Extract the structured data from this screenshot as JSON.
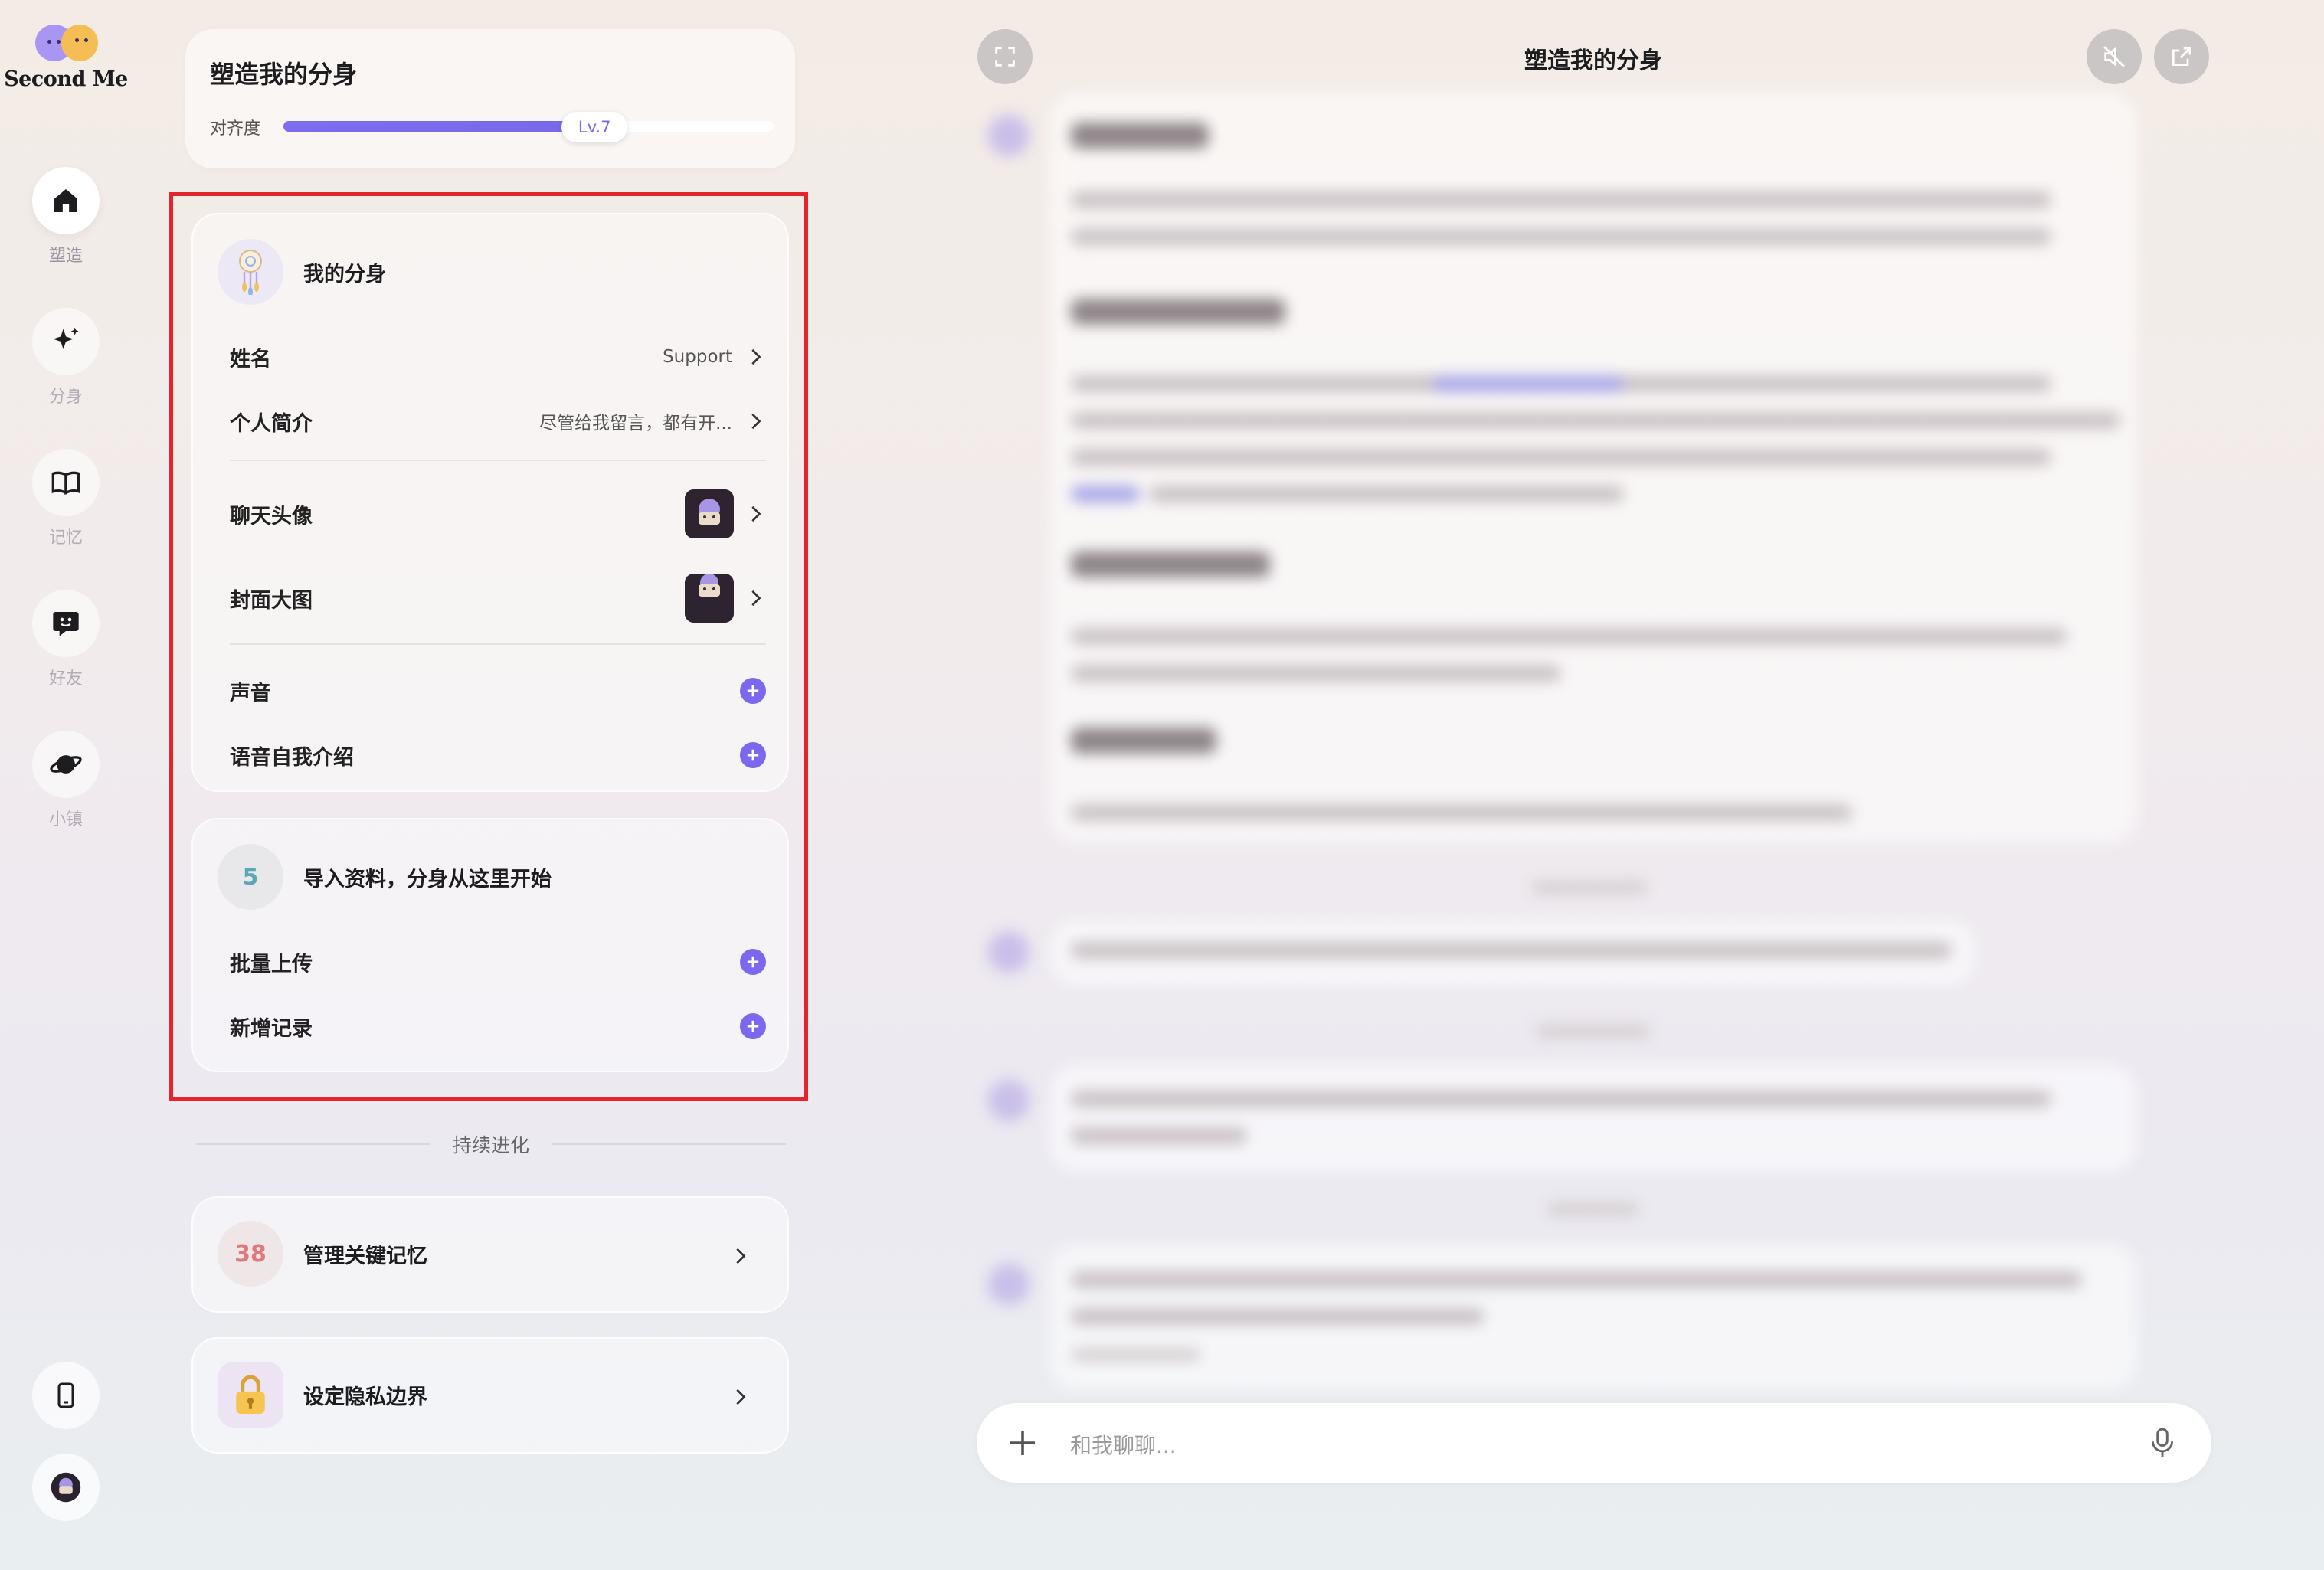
{
  "app": {
    "logo_text": "Second Me"
  },
  "nav": {
    "items": [
      {
        "label": "塑造",
        "icon": "home-icon",
        "active": true
      },
      {
        "label": "分身",
        "icon": "sparkle-icon",
        "active": false
      },
      {
        "label": "记忆",
        "icon": "book-icon",
        "active": false
      },
      {
        "label": "好友",
        "icon": "chat-face-icon",
        "active": false
      },
      {
        "label": "小镇",
        "icon": "planet-icon",
        "active": false
      }
    ],
    "bottom": [
      {
        "icon": "phone-icon"
      },
      {
        "icon": "user-avatar-icon"
      }
    ]
  },
  "alignment": {
    "title": "塑造我的分身",
    "label": "对齐度",
    "level": "Lv.7",
    "progress": 0.58
  },
  "profile_card": {
    "title": "我的分身",
    "rows": [
      {
        "label": "姓名",
        "value": "Support"
      },
      {
        "label": "个人简介",
        "value": "尽管给我留言，都有开..."
      },
      {
        "label": "聊天头像"
      },
      {
        "label": "封面大图"
      },
      {
        "label": "声音"
      },
      {
        "label": "语音自我介绍"
      }
    ]
  },
  "import_card": {
    "count": "5",
    "title": "导入资料，分身从这里开始",
    "rows": [
      {
        "label": "批量上传"
      },
      {
        "label": "新增记录"
      }
    ]
  },
  "evolve": {
    "label": "持续进化"
  },
  "memory_card": {
    "count": "38",
    "title": "管理关键记忆"
  },
  "privacy_card": {
    "title": "设定隐私边界"
  },
  "chat": {
    "title": "塑造我的分身",
    "input_placeholder": "和我聊聊..."
  },
  "colors": {
    "accent": "#7b68ee",
    "highlight": "#e3242b",
    "memory_count": "#e07a7a",
    "import_count": "#5aa7b8"
  }
}
